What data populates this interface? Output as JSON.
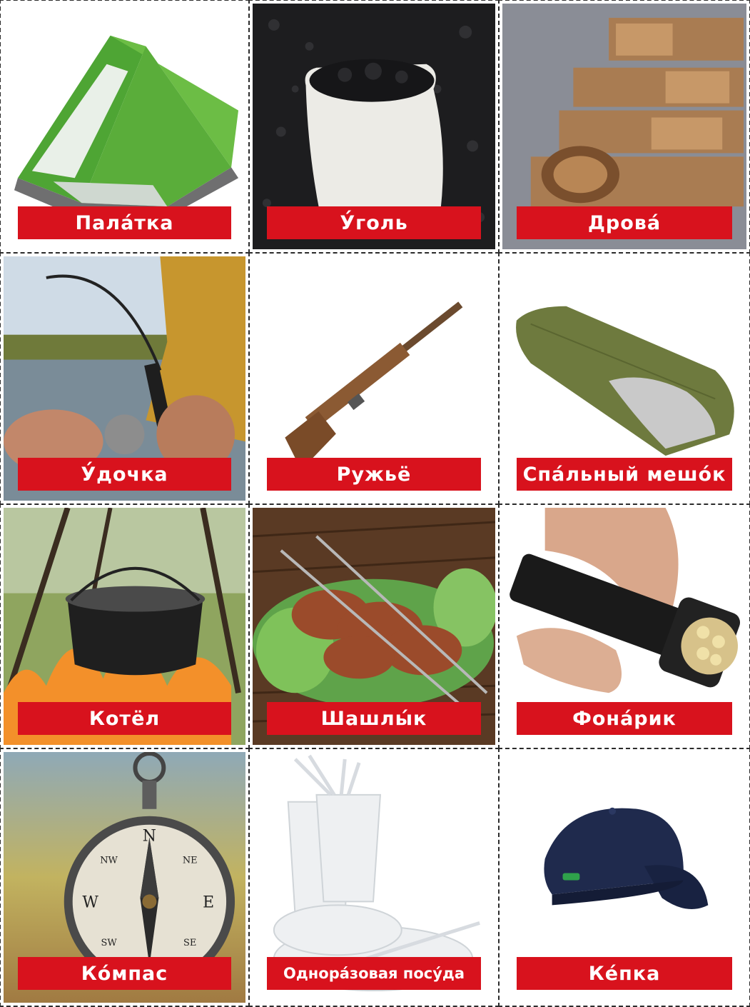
{
  "cards": [
    {
      "label": "Пала́тка"
    },
    {
      "label": "У́голь"
    },
    {
      "label": "Дрова́"
    },
    {
      "label": "У́дочка"
    },
    {
      "label": "Ружьё"
    },
    {
      "label": "Спа́льный мешо́к"
    },
    {
      "label": "Котёл"
    },
    {
      "label": "Шашлы́к"
    },
    {
      "label": "Фона́рик"
    },
    {
      "label": "Ко́мпас"
    },
    {
      "label": "Однора́зовая посу́да"
    },
    {
      "label": "Ке́пка"
    }
  ],
  "colors": {
    "label_bg": "#d8121d",
    "label_text": "#ffffff",
    "border": "#2b2b2b"
  },
  "compass_letters": {
    "n": "N",
    "e": "E",
    "s": "S",
    "w": "W",
    "ne": "NE",
    "se": "SE",
    "sw": "SW",
    "nw": "NW"
  }
}
